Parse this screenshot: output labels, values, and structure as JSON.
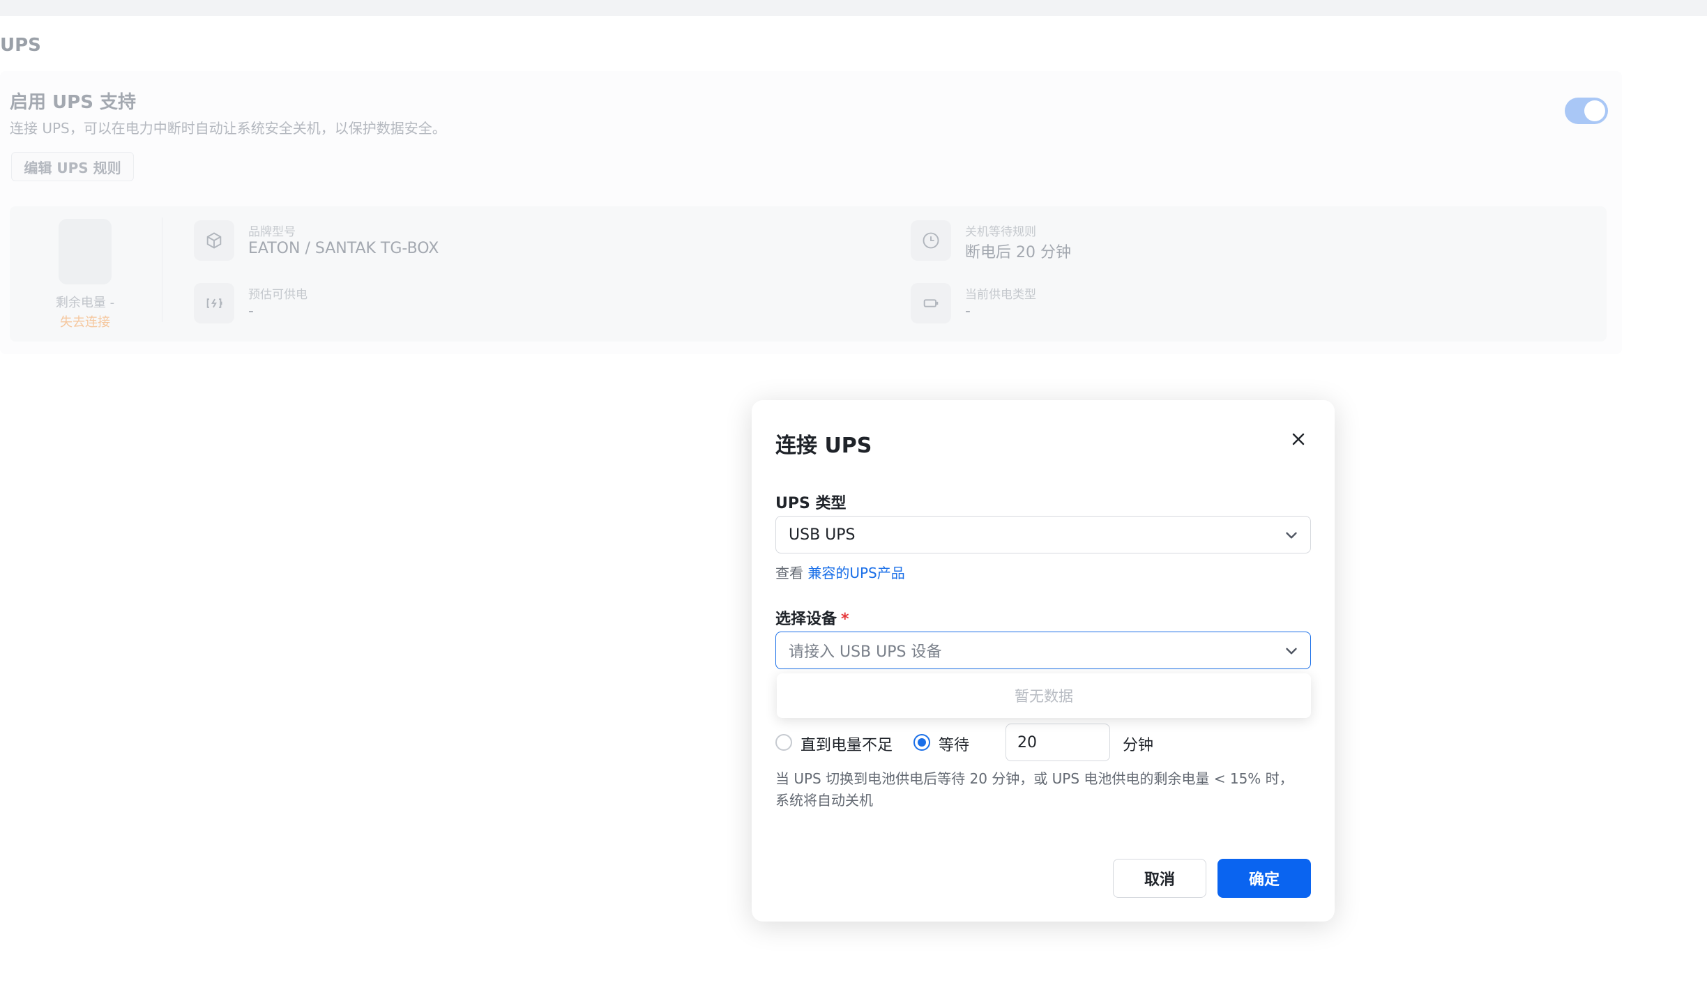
{
  "page": {
    "title": "UPS"
  },
  "settings_card": {
    "title": "启用 UPS 支持",
    "description": "连接 UPS，可以在电力中断时自动让系统安全关机，以保护数据安全。",
    "edit_rule_label": "编辑 UPS 规则",
    "toggle_on": true
  },
  "status": {
    "battery_label": "剩余电量 -",
    "connection_status": "失去连接",
    "brand_label": "品牌型号",
    "brand_value": "EATON / SANTAK TG-BOX",
    "runtime_label": "预估可供电",
    "runtime_value": "-",
    "shutdown_rule_label": "关机等待规则",
    "shutdown_rule_value": "断电后 20 分钟",
    "power_type_label": "当前供电类型",
    "power_type_value": "-"
  },
  "dialog": {
    "title": "连接 UPS",
    "ups_type_label": "UPS 类型",
    "ups_type_value": "USB UPS",
    "hint_prefix": "查看 ",
    "hint_link": "兼容的UPS产品",
    "device_label": "选择设备",
    "required_mark": "*",
    "device_placeholder": "请接入 USB UPS 设备",
    "dropdown_empty": "暂无数据",
    "option_low_battery": "直到电量不足",
    "option_wait": "等待",
    "wait_minutes": "20",
    "minutes_unit": "分钟",
    "selected_option": "wait",
    "note": "当 UPS 切换到电池供电后等待 20 分钟，或 UPS 电池供电的剩余电量 < 15% 时，系统将自动关机",
    "cancel_label": "取消",
    "ok_label": "确定"
  },
  "colors": {
    "primary": "#0a64f0",
    "link": "#1a6fe8",
    "warning": "#f5c79e",
    "required": "#e5373a"
  }
}
